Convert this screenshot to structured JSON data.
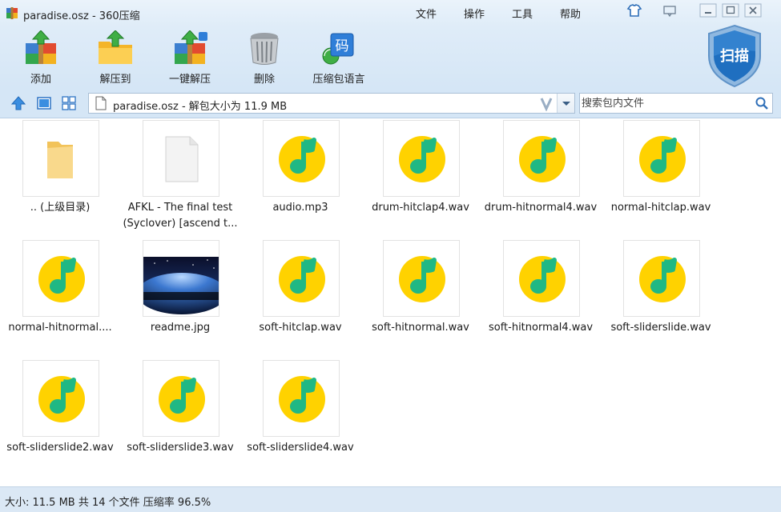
{
  "window": {
    "title": "paradise.osz - 360压缩",
    "menu": [
      "文件",
      "操作",
      "工具",
      "帮助"
    ]
  },
  "toolbar": {
    "add_label": "添加",
    "extract_to_label": "解压到",
    "one_click_extract_label": "一键解压",
    "delete_label": "删除",
    "archive_language_label": "压缩包语言",
    "scan_label": "扫描",
    "lang_badge": "码"
  },
  "address": {
    "path": "paradise.osz - 解包大小为 11.9 MB"
  },
  "search": {
    "placeholder": "搜索包内文件"
  },
  "files": [
    {
      "name": ".. (上级目录)",
      "type": "folder-up"
    },
    {
      "name": "AFKL - The final test",
      "name_line2": "(Syclover) [ascend t...",
      "type": "document"
    },
    {
      "name": "audio.mp3",
      "type": "audio"
    },
    {
      "name": "drum-hitclap4.wav",
      "type": "audio"
    },
    {
      "name": "drum-hitnormal4.wav",
      "type": "audio"
    },
    {
      "name": "normal-hitclap.wav",
      "type": "audio"
    },
    {
      "name": "normal-hitnormal....",
      "type": "audio"
    },
    {
      "name": "readme.jpg",
      "type": "image"
    },
    {
      "name": "soft-hitclap.wav",
      "type": "audio"
    },
    {
      "name": "soft-hitnormal.wav",
      "type": "audio"
    },
    {
      "name": "soft-hitnormal4.wav",
      "type": "audio"
    },
    {
      "name": "soft-sliderslide.wav",
      "type": "audio"
    },
    {
      "name": "soft-sliderslide2.wav",
      "type": "audio"
    },
    {
      "name": "soft-sliderslide3.wav",
      "type": "audio"
    },
    {
      "name": "soft-sliderslide4.wav",
      "type": "audio"
    }
  ],
  "status": {
    "text": "大小: 11.5 MB 共 14 个文件 压缩率 96.5%"
  },
  "colors": {
    "titlebar": "#eaf3fb",
    "toolbar": "#d5e6f6",
    "audio_icon_yellow": "#ffd200",
    "audio_icon_green": "#20b884",
    "scan_shield": "#1f6fc0"
  }
}
